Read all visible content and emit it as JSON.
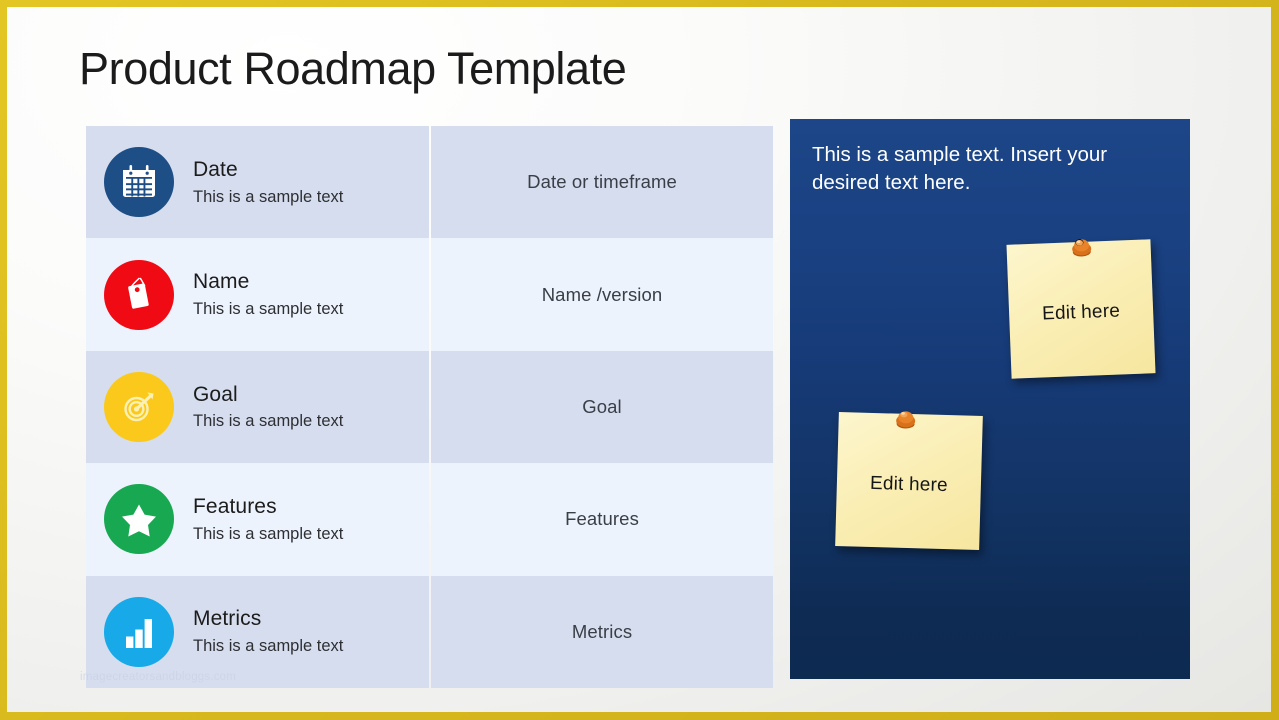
{
  "slide": {
    "title": "Product Roadmap Template",
    "watermark": "imagecreatorsandbloggs.com",
    "border_color": "#d9b820",
    "background_color": "#f2f2f0"
  },
  "table": {
    "rows": [
      {
        "icon": "calendar-icon",
        "icon_bg": "#1d4e86",
        "heading": "Date",
        "subtext": "This is a sample text",
        "value": "Date or timeframe",
        "shade": "dark"
      },
      {
        "icon": "price-tag-icon",
        "icon_bg": "#ef0a14",
        "heading": "Name",
        "subtext": "This is a sample text",
        "value": "Name  /version",
        "shade": "light"
      },
      {
        "icon": "target-icon",
        "icon_bg": "#fbc91b",
        "heading": "Goal",
        "subtext": "This is a sample text",
        "value": "Goal",
        "shade": "dark"
      },
      {
        "icon": "star-icon",
        "icon_bg": "#18a851",
        "heading": "Features",
        "subtext": "This is a sample text",
        "value": "Features",
        "shade": "light"
      },
      {
        "icon": "bar-chart-icon",
        "icon_bg": "#17a9e8",
        "heading": "Metrics",
        "subtext": "This is a sample text",
        "value": "Metrics",
        "shade": "dark"
      }
    ]
  },
  "panel": {
    "background_top_color": "#1c4688",
    "background_bottom_color": "#0d2a51",
    "text": "This is a sample text. Insert your desired text here.",
    "notes": [
      {
        "label": "Edit here",
        "pin": "pushpin-icon",
        "pin_color": "#d9701a",
        "paper_color": "#faeeb4"
      },
      {
        "label": "Edit here",
        "pin": "pushpin-icon",
        "pin_color": "#d9701a",
        "paper_color": "#faeeb4"
      }
    ]
  }
}
